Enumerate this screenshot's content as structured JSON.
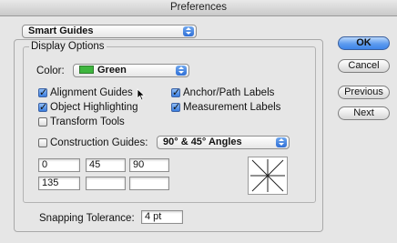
{
  "window": {
    "title": "Preferences"
  },
  "section_select": {
    "value": "Smart Guides"
  },
  "display_options": {
    "legend": "Display Options",
    "color_label": "Color:",
    "color_value": "Green",
    "color_swatch": "#3fb63f",
    "checkboxes": {
      "alignment_guides": {
        "label": "Alignment Guides",
        "checked": true
      },
      "anchor_path_labels": {
        "label": "Anchor/Path Labels",
        "checked": true
      },
      "object_highlighting": {
        "label": "Object Highlighting",
        "checked": true
      },
      "measurement_labels": {
        "label": "Measurement Labels",
        "checked": true
      },
      "transform_tools": {
        "label": "Transform Tools",
        "checked": false
      },
      "construction_guides": {
        "label": "Construction Guides:",
        "checked": false
      }
    },
    "angles_select": "90° & 45° Angles",
    "angles": [
      "0",
      "45",
      "90",
      "135",
      "",
      ""
    ],
    "preview_icon": "angle-lines-icon"
  },
  "snapping": {
    "label": "Snapping Tolerance:",
    "value": "4 pt"
  },
  "buttons": {
    "ok": "OK",
    "cancel": "Cancel",
    "previous": "Previous",
    "next": "Next"
  },
  "colors": {
    "accent": "#3e85ea"
  }
}
